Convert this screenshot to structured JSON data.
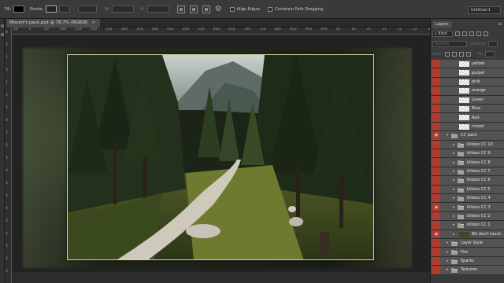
{
  "options_bar": {
    "fill_label": "Fill:",
    "stroke_label": "Stroke:",
    "w_label": "W:",
    "h_label": "H:",
    "align_edges": "Align Edges",
    "constrain": "Constrain Path Dragging",
    "workspace": "Untitled-1"
  },
  "document": {
    "tab_title": "Mounir's pack.psd @ 78,7% (RGB/8)",
    "close_glyph": "×"
  },
  "ruler_top": [
    "50",
    "0",
    "50",
    "100",
    "150",
    "200",
    "250",
    "300",
    "350",
    "400",
    "450",
    "500",
    "550",
    "600",
    "650",
    "700",
    "750",
    "800",
    "850",
    "900",
    "950",
    "10",
    "10",
    "11",
    "11",
    "12",
    "12",
    "13"
  ],
  "ruler_left": [
    "0",
    "5",
    "1",
    "0",
    "1",
    "5",
    "2",
    "0",
    "2",
    "5",
    "3",
    "0",
    "3",
    "5",
    "4",
    "0",
    "4",
    "5",
    "5",
    "0"
  ],
  "layers_panel": {
    "tab": "Layers",
    "kind": "Kind",
    "blend": "Normal",
    "opacity": "Opacity:",
    "lock": "Lock:",
    "fill": "Fill:",
    "layers": [
      {
        "name": "yellow",
        "type": "layer",
        "visible": false
      },
      {
        "name": "purpel",
        "type": "layer",
        "visible": false
      },
      {
        "name": "pink",
        "type": "layer",
        "visible": false
      },
      {
        "name": "orange",
        "type": "layer",
        "visible": false
      },
      {
        "name": "Green",
        "type": "layer",
        "visible": false
      },
      {
        "name": "Blue",
        "type": "layer",
        "visible": false
      },
      {
        "name": "Red",
        "type": "layer",
        "visible": false
      },
      {
        "name": "mixed",
        "type": "layer",
        "visible": false
      },
      {
        "name": "CC pack",
        "type": "group-open",
        "visible": true
      },
      {
        "name": "killooo CC 10",
        "type": "group",
        "visible": false
      },
      {
        "name": "killooo CC 9",
        "type": "group",
        "visible": false
      },
      {
        "name": "killooo CC 8",
        "type": "group",
        "visible": false
      },
      {
        "name": "killooo CC 7",
        "type": "group",
        "visible": false
      },
      {
        "name": "killooo CC 6",
        "type": "group",
        "visible": false
      },
      {
        "name": "killooo CC 5",
        "type": "group",
        "visible": false
      },
      {
        "name": "killooo CC 4",
        "type": "group",
        "visible": false
      },
      {
        "name": "killooo CC 3",
        "type": "group",
        "visible": true
      },
      {
        "name": "killooo CC 2",
        "type": "group",
        "visible": false
      },
      {
        "name": "killooo CC 1",
        "type": "group",
        "visible": false
      },
      {
        "name": "BG don't touch",
        "type": "layer-photo",
        "visible": true
      },
      {
        "name": "Layer Style",
        "type": "group-top",
        "visible": false
      },
      {
        "name": "Fire",
        "type": "group-top",
        "visible": false
      },
      {
        "name": "Sparks",
        "type": "group-top",
        "visible": false
      },
      {
        "name": "Textures",
        "type": "group-top",
        "visible": false
      }
    ]
  },
  "colors": {
    "eye_column": "#b23a2e",
    "panel_bg": "#3a3a3a",
    "row_bg": "#535353"
  }
}
